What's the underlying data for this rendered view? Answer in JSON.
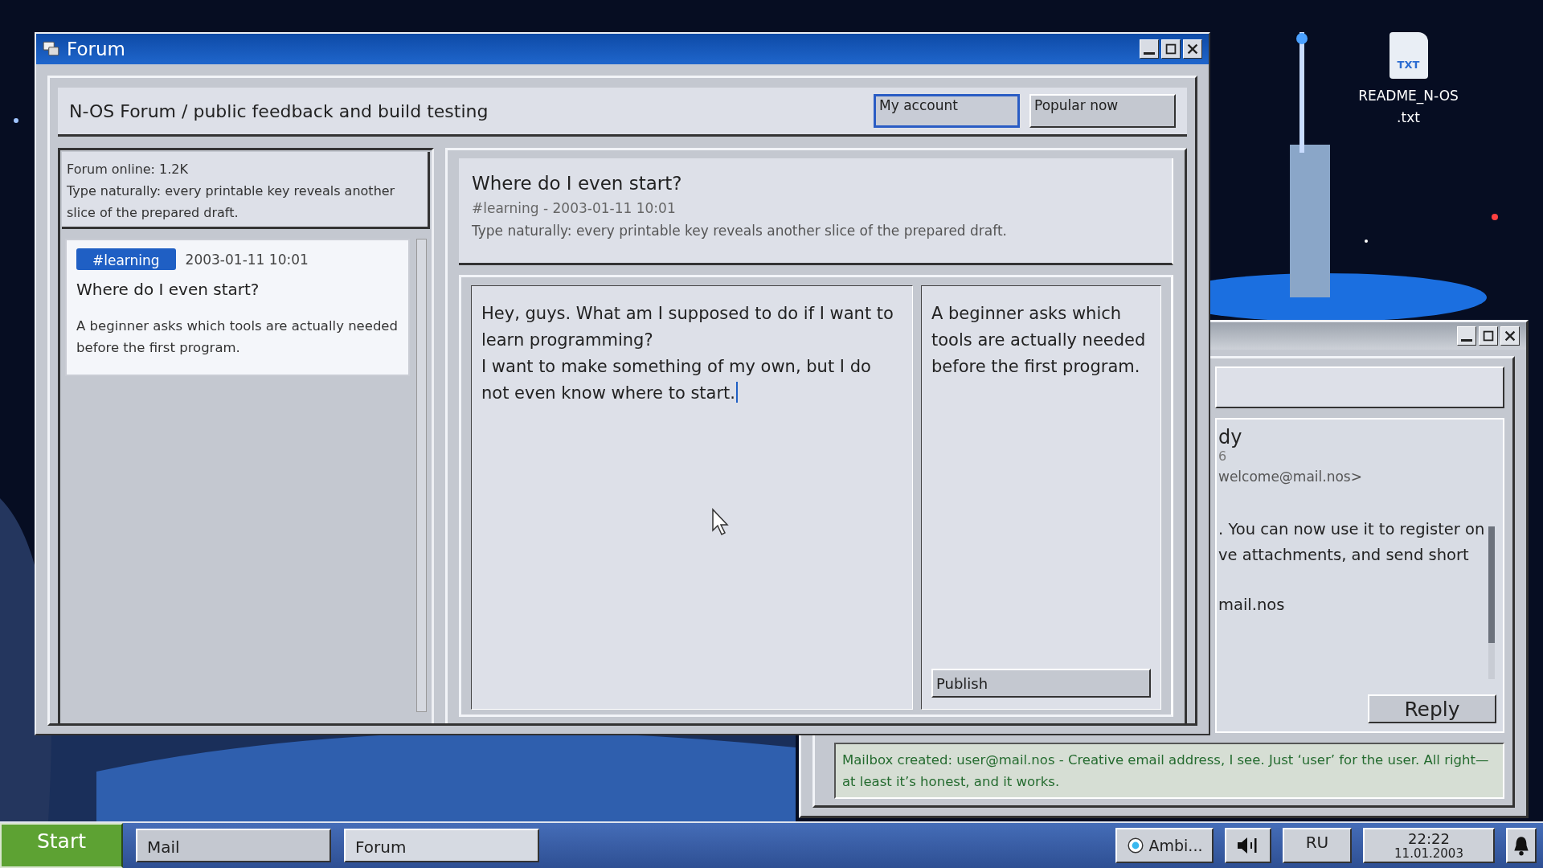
{
  "desktop": {
    "icons": [
      {
        "label": "README_N-OS\n.txt",
        "badge": "TXT"
      }
    ]
  },
  "forum": {
    "title": "Forum",
    "header": {
      "title": "N-OS Forum / public feedback and build testing",
      "buttons": [
        {
          "label": "My account",
          "selected": true
        },
        {
          "label": "Popular now",
          "selected": false
        }
      ]
    },
    "sidebar": {
      "online": "Forum online: 1.2K",
      "hint": "Type naturally: every printable key reveals another slice of the prepared draft.",
      "posts": [
        {
          "tag": "#learning",
          "date": "2003-01-11 10:01",
          "title": "Where do I even start?",
          "summary": "A beginner asks which tools are actually needed before the first program.",
          "selected": true
        }
      ]
    },
    "topic": {
      "title": "Where do I even start?",
      "meta": "#learning - 2003-01-11 10:01",
      "description": "Type naturally: every printable key reveals another slice of the prepared draft."
    },
    "editor": {
      "value": "Hey, guys. What am I supposed to do if I want to learn programming?\nI want to make something of my own, but I do not even know where to start.",
      "summary": "A beginner asks which tools are actually needed before the first program.",
      "publish": "Publish"
    }
  },
  "mail": {
    "from_name": "dy",
    "date": "6",
    "from_address": "welcome@mail.nos>",
    "body_paragraphs": [
      ". You can now use it to register on\nve attachments, and send short",
      "mail.nos"
    ],
    "reply": "Reply",
    "status": "Mailbox created: user@mail.nos - Creative email address, I see. Just ‘user’ for the user. All right—at least it’s honest, and it works."
  },
  "taskbar": {
    "start": "Start",
    "tasks": [
      {
        "label": "Mail",
        "selected": false
      },
      {
        "label": "Forum",
        "selected": true
      }
    ],
    "media": "Ambi...",
    "language": "RU",
    "time": "22:22",
    "date": "11.01.2003"
  }
}
